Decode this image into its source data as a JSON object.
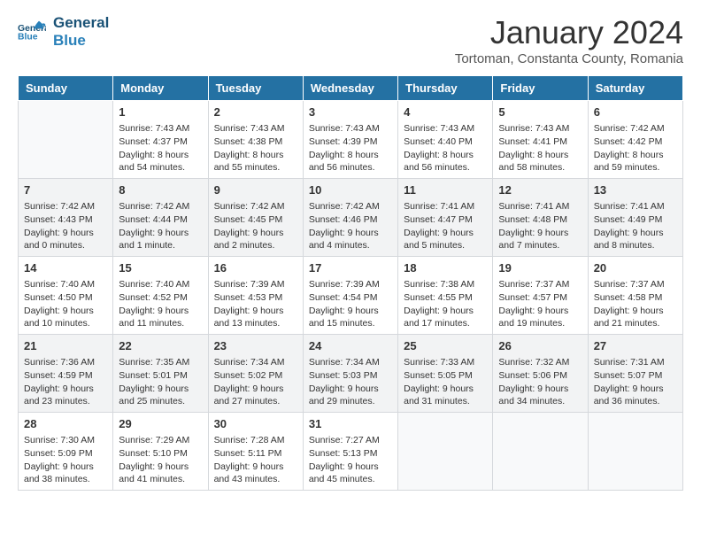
{
  "header": {
    "logo_line1": "General",
    "logo_line2": "Blue",
    "month_title": "January 2024",
    "location": "Tortoman, Constanta County, Romania"
  },
  "days_of_week": [
    "Sunday",
    "Monday",
    "Tuesday",
    "Wednesday",
    "Thursday",
    "Friday",
    "Saturday"
  ],
  "weeks": [
    [
      {
        "day": "",
        "info": ""
      },
      {
        "day": "1",
        "info": "Sunrise: 7:43 AM\nSunset: 4:37 PM\nDaylight: 8 hours\nand 54 minutes."
      },
      {
        "day": "2",
        "info": "Sunrise: 7:43 AM\nSunset: 4:38 PM\nDaylight: 8 hours\nand 55 minutes."
      },
      {
        "day": "3",
        "info": "Sunrise: 7:43 AM\nSunset: 4:39 PM\nDaylight: 8 hours\nand 56 minutes."
      },
      {
        "day": "4",
        "info": "Sunrise: 7:43 AM\nSunset: 4:40 PM\nDaylight: 8 hours\nand 56 minutes."
      },
      {
        "day": "5",
        "info": "Sunrise: 7:43 AM\nSunset: 4:41 PM\nDaylight: 8 hours\nand 58 minutes."
      },
      {
        "day": "6",
        "info": "Sunrise: 7:42 AM\nSunset: 4:42 PM\nDaylight: 8 hours\nand 59 minutes."
      }
    ],
    [
      {
        "day": "7",
        "info": "Sunrise: 7:42 AM\nSunset: 4:43 PM\nDaylight: 9 hours\nand 0 minutes."
      },
      {
        "day": "8",
        "info": "Sunrise: 7:42 AM\nSunset: 4:44 PM\nDaylight: 9 hours\nand 1 minute."
      },
      {
        "day": "9",
        "info": "Sunrise: 7:42 AM\nSunset: 4:45 PM\nDaylight: 9 hours\nand 2 minutes."
      },
      {
        "day": "10",
        "info": "Sunrise: 7:42 AM\nSunset: 4:46 PM\nDaylight: 9 hours\nand 4 minutes."
      },
      {
        "day": "11",
        "info": "Sunrise: 7:41 AM\nSunset: 4:47 PM\nDaylight: 9 hours\nand 5 minutes."
      },
      {
        "day": "12",
        "info": "Sunrise: 7:41 AM\nSunset: 4:48 PM\nDaylight: 9 hours\nand 7 minutes."
      },
      {
        "day": "13",
        "info": "Sunrise: 7:41 AM\nSunset: 4:49 PM\nDaylight: 9 hours\nand 8 minutes."
      }
    ],
    [
      {
        "day": "14",
        "info": "Sunrise: 7:40 AM\nSunset: 4:50 PM\nDaylight: 9 hours\nand 10 minutes."
      },
      {
        "day": "15",
        "info": "Sunrise: 7:40 AM\nSunset: 4:52 PM\nDaylight: 9 hours\nand 11 minutes."
      },
      {
        "day": "16",
        "info": "Sunrise: 7:39 AM\nSunset: 4:53 PM\nDaylight: 9 hours\nand 13 minutes."
      },
      {
        "day": "17",
        "info": "Sunrise: 7:39 AM\nSunset: 4:54 PM\nDaylight: 9 hours\nand 15 minutes."
      },
      {
        "day": "18",
        "info": "Sunrise: 7:38 AM\nSunset: 4:55 PM\nDaylight: 9 hours\nand 17 minutes."
      },
      {
        "day": "19",
        "info": "Sunrise: 7:37 AM\nSunset: 4:57 PM\nDaylight: 9 hours\nand 19 minutes."
      },
      {
        "day": "20",
        "info": "Sunrise: 7:37 AM\nSunset: 4:58 PM\nDaylight: 9 hours\nand 21 minutes."
      }
    ],
    [
      {
        "day": "21",
        "info": "Sunrise: 7:36 AM\nSunset: 4:59 PM\nDaylight: 9 hours\nand 23 minutes."
      },
      {
        "day": "22",
        "info": "Sunrise: 7:35 AM\nSunset: 5:01 PM\nDaylight: 9 hours\nand 25 minutes."
      },
      {
        "day": "23",
        "info": "Sunrise: 7:34 AM\nSunset: 5:02 PM\nDaylight: 9 hours\nand 27 minutes."
      },
      {
        "day": "24",
        "info": "Sunrise: 7:34 AM\nSunset: 5:03 PM\nDaylight: 9 hours\nand 29 minutes."
      },
      {
        "day": "25",
        "info": "Sunrise: 7:33 AM\nSunset: 5:05 PM\nDaylight: 9 hours\nand 31 minutes."
      },
      {
        "day": "26",
        "info": "Sunrise: 7:32 AM\nSunset: 5:06 PM\nDaylight: 9 hours\nand 34 minutes."
      },
      {
        "day": "27",
        "info": "Sunrise: 7:31 AM\nSunset: 5:07 PM\nDaylight: 9 hours\nand 36 minutes."
      }
    ],
    [
      {
        "day": "28",
        "info": "Sunrise: 7:30 AM\nSunset: 5:09 PM\nDaylight: 9 hours\nand 38 minutes."
      },
      {
        "day": "29",
        "info": "Sunrise: 7:29 AM\nSunset: 5:10 PM\nDaylight: 9 hours\nand 41 minutes."
      },
      {
        "day": "30",
        "info": "Sunrise: 7:28 AM\nSunset: 5:11 PM\nDaylight: 9 hours\nand 43 minutes."
      },
      {
        "day": "31",
        "info": "Sunrise: 7:27 AM\nSunset: 5:13 PM\nDaylight: 9 hours\nand 45 minutes."
      },
      {
        "day": "",
        "info": ""
      },
      {
        "day": "",
        "info": ""
      },
      {
        "day": "",
        "info": ""
      }
    ]
  ]
}
